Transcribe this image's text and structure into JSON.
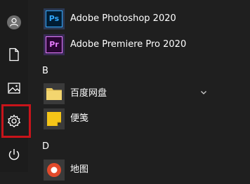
{
  "colors": {
    "background": "#1f1f1f",
    "rail": "#1c1c1c",
    "highlight": "#c8141a",
    "text": "#ffffff"
  },
  "rail": {
    "icons": [
      "user-icon",
      "document-icon",
      "pictures-icon",
      "settings-icon",
      "power-icon"
    ]
  },
  "apps": {
    "photoshop": {
      "label": "Adobe Photoshop 2020",
      "badge": "Ps"
    },
    "premiere": {
      "label": "Adobe Premiere Pro 2020",
      "badge": "Pr"
    },
    "section_b": "B",
    "baidu": {
      "label": "百度网盘"
    },
    "notes": {
      "label": "便笺"
    },
    "section_d": "D",
    "maps": {
      "label": "地图"
    }
  }
}
